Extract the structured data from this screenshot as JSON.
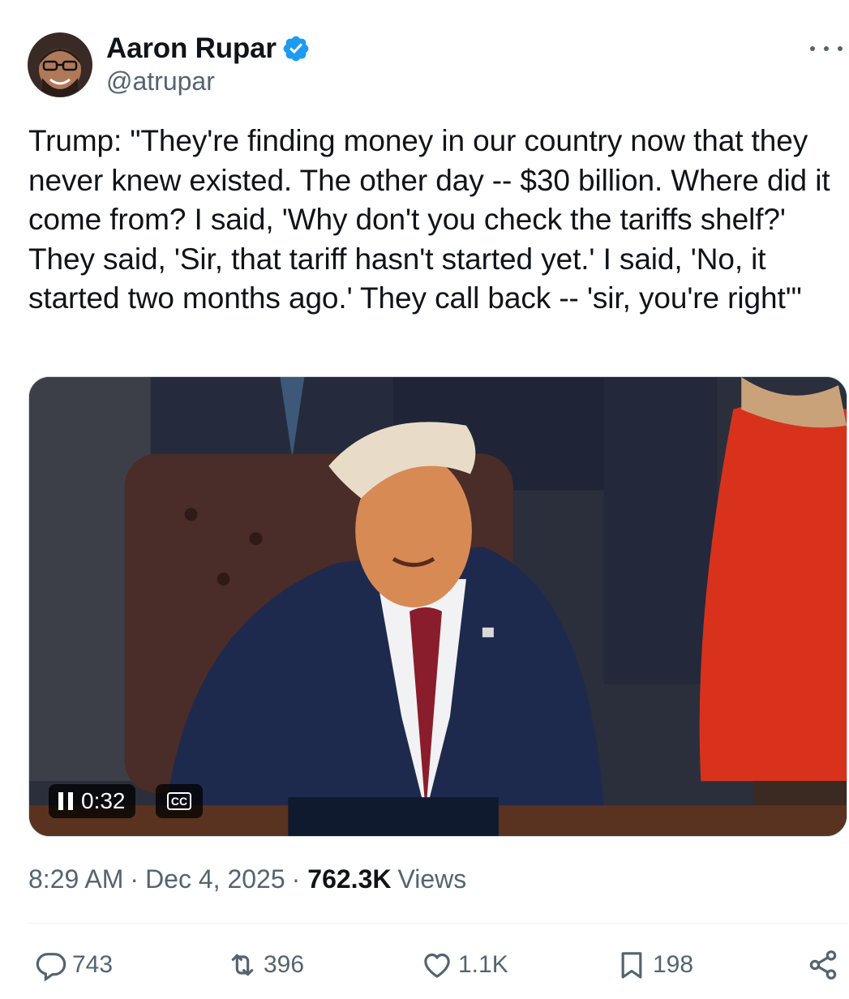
{
  "author": {
    "name": "Aaron Rupar",
    "handle": "@atrupar",
    "verified": true,
    "verified_color": "#1d9bf0"
  },
  "tweet": {
    "text": "Trump: \"They're finding money in our country now that they never knew existed. The other day -- $30 billion. Where did it come from? I said, 'Why don't you check the tariffs shelf?' They said, 'Sir, that tariff hasn't started yet.' I said, 'No, it started two months ago.' They call back -- 'sir, you're right'\""
  },
  "video": {
    "elapsed": "0:32",
    "cc_label": "CC",
    "state": "playing"
  },
  "meta": {
    "time": "8:29 AM",
    "separator": "·",
    "date": "Dec 4, 2025",
    "views_count": "762.3K",
    "views_label": "Views"
  },
  "actions": {
    "replies": "743",
    "reposts": "396",
    "likes": "1.1K",
    "bookmarks": "198"
  },
  "icons": {
    "more": "more-horizontal-icon",
    "reply": "reply-icon",
    "repost": "repost-icon",
    "like": "heart-icon",
    "bookmark": "bookmark-icon",
    "share": "share-icon"
  },
  "colors": {
    "text": "#0f1419",
    "secondary": "#536471",
    "accent": "#1d9bf0"
  }
}
